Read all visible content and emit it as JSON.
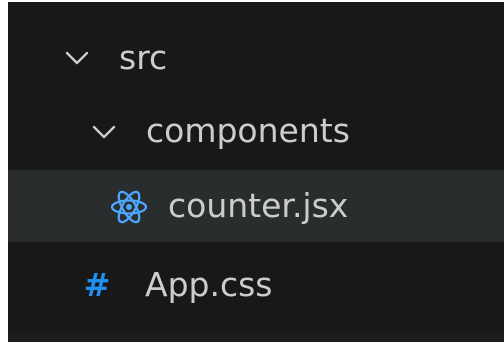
{
  "explorer": {
    "items": [
      {
        "label": "src",
        "type": "folder",
        "expanded": true,
        "icon": "chevron-down-icon"
      },
      {
        "label": "components",
        "type": "folder",
        "expanded": true,
        "icon": "chevron-down-icon"
      },
      {
        "label": "counter.jsx",
        "type": "file",
        "selected": true,
        "icon": "react-icon",
        "icon_color": "#4ea7ff"
      },
      {
        "label": "App.css",
        "type": "file",
        "icon": "hash-icon",
        "icon_glyph": "#",
        "icon_color": "#1f8ff0"
      }
    ]
  },
  "colors": {
    "background": "#181818",
    "text": "#cccccc",
    "selected_row": "#2a2d2e",
    "react_blue": "#4ea7ff",
    "css_blue": "#1f8ff0"
  }
}
